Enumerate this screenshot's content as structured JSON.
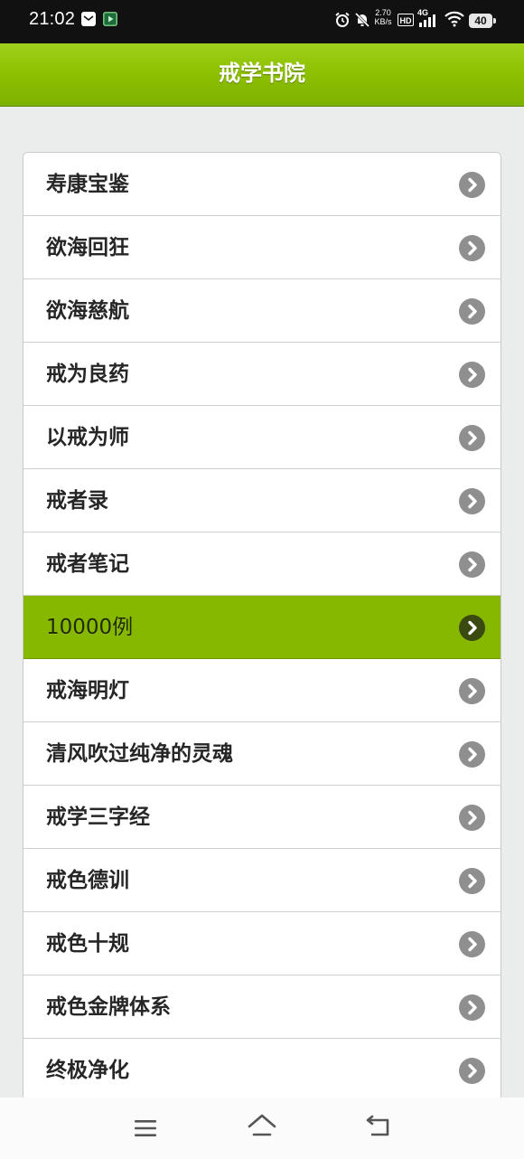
{
  "status_bar": {
    "time": "21:02",
    "speed_value": "2.70",
    "speed_unit": "KB/s",
    "hd": "HD",
    "network": "4G",
    "battery": "40",
    "icons": [
      "mail-icon",
      "video-app-icon",
      "alarm-icon",
      "mute-icon",
      "signal-icon",
      "wifi-icon",
      "battery-icon"
    ]
  },
  "header": {
    "title": "戒学书院"
  },
  "list": {
    "items": [
      {
        "label": "寿康宝鉴"
      },
      {
        "label": "欲海回狂"
      },
      {
        "label": "欲海慈航"
      },
      {
        "label": "戒为良药"
      },
      {
        "label": "以戒为师"
      },
      {
        "label": "戒者录"
      },
      {
        "label": "戒者笔记"
      },
      {
        "label": "10000例"
      },
      {
        "label": "戒海明灯"
      },
      {
        "label": "清风吹过纯净的灵魂"
      },
      {
        "label": "戒学三字经"
      },
      {
        "label": "戒色德训"
      },
      {
        "label": "戒色十规"
      },
      {
        "label": "戒色金牌体系"
      },
      {
        "label": "终极净化"
      }
    ],
    "active_index": 7
  },
  "colors": {
    "accent": "#8ec100",
    "active_row": "#86b800",
    "background": "#ebecec"
  },
  "nav": {
    "icons": [
      "menu-icon",
      "home-icon",
      "back-icon"
    ]
  }
}
